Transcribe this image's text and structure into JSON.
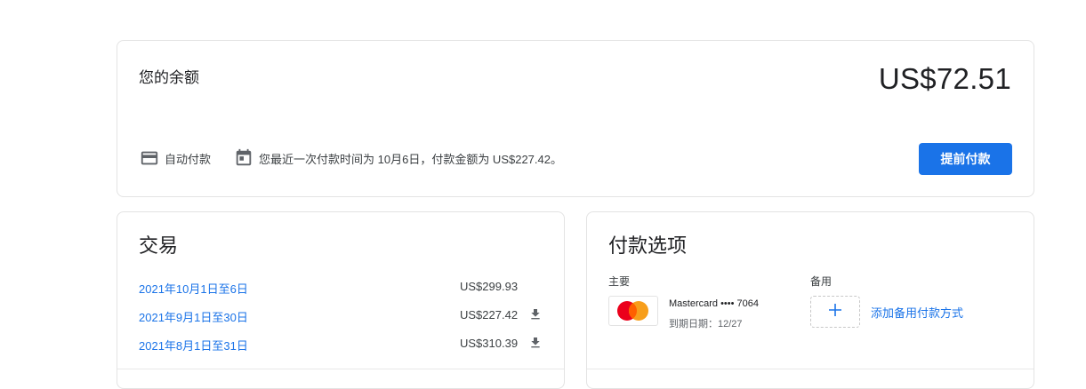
{
  "balance": {
    "title": "您的余额",
    "amount": "US$72.51",
    "auto_pay_label": "自动付款",
    "last_payment_text": "您最近一次付款时间为 10月6日，付款金额为 US$227.42。",
    "pay_early_button": "提前付款"
  },
  "transactions": {
    "title": "交易",
    "rows": [
      {
        "period": "2021年10月1日至6日",
        "amount": "US$299.93",
        "download": false
      },
      {
        "period": "2021年9月1日至30日",
        "amount": "US$227.42",
        "download": true
      },
      {
        "period": "2021年8月1日至31日",
        "amount": "US$310.39",
        "download": true
      }
    ]
  },
  "payment_options": {
    "title": "付款选项",
    "primary_label": "主要",
    "backup_label": "备用",
    "card_name": "Mastercard •••• 7064",
    "card_expiry": "到期日期：12/27",
    "add_backup_label": "添加备用付款方式"
  },
  "icons": {
    "credit_card": "credit-card-icon",
    "calendar": "calendar-icon",
    "download": "download-icon",
    "add": "plus-icon",
    "mastercard": "mastercard-logo"
  },
  "colors": {
    "accent": "#1a73e8",
    "mastercard_red": "#eb001b",
    "mastercard_orange": "#f79e1b"
  }
}
